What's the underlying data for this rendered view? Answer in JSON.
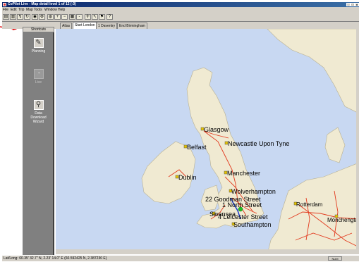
{
  "window": {
    "title": "CoPilot Live - Map detail level 1 of 12 (-3)",
    "controls": [
      "_",
      "□",
      "x"
    ]
  },
  "menu": [
    "File",
    "Edit",
    "Trip",
    "Map",
    "Tools",
    "Window",
    "Help"
  ],
  "tabs": [
    {
      "label": "Atlas",
      "active": false
    },
    {
      "label": "Start London",
      "active": true
    },
    {
      "label": "1 Daventry",
      "active": false
    },
    {
      "label": "End Birmingham",
      "active": false
    }
  ],
  "sidebar": {
    "header": "Shortcuts",
    "items": [
      {
        "label": "Planning",
        "icon": "route-planning-icon",
        "enabled": true
      },
      {
        "label": "Live",
        "icon": "live-navigation-icon",
        "enabled": false
      },
      {
        "label": "Data Download Wizard",
        "icon": "satellite-dish-icon",
        "enabled": true
      }
    ]
  },
  "map": {
    "cities": [
      {
        "name": "Glasgow"
      },
      {
        "name": "Belfast"
      },
      {
        "name": "Newcastle Upon Tyne"
      },
      {
        "name": "Dublin"
      },
      {
        "name": "Manchester"
      },
      {
        "name": "Wolverhampton"
      },
      {
        "name": "22 Goodman Street"
      },
      {
        "name": "1 North Street"
      },
      {
        "name": "Swansea"
      },
      {
        "name": "4 Leicester Street"
      },
      {
        "name": "Southampton"
      },
      {
        "name": "Rotterdam"
      },
      {
        "name": "Mönchengladbach"
      }
    ]
  },
  "status": {
    "latlong": "Lat/Long: 60.35' 32.7\" N,  2.23' 14.0\" E (60.592425 N, 2.387230 E)",
    "num": "NUM"
  },
  "colors": {
    "sea": "#c8d8f2",
    "land": "#f0ead2",
    "roads": "#e23a1e",
    "sidebar": "#808080",
    "chrome": "#d4d0c8",
    "arrow": "#e01010"
  }
}
